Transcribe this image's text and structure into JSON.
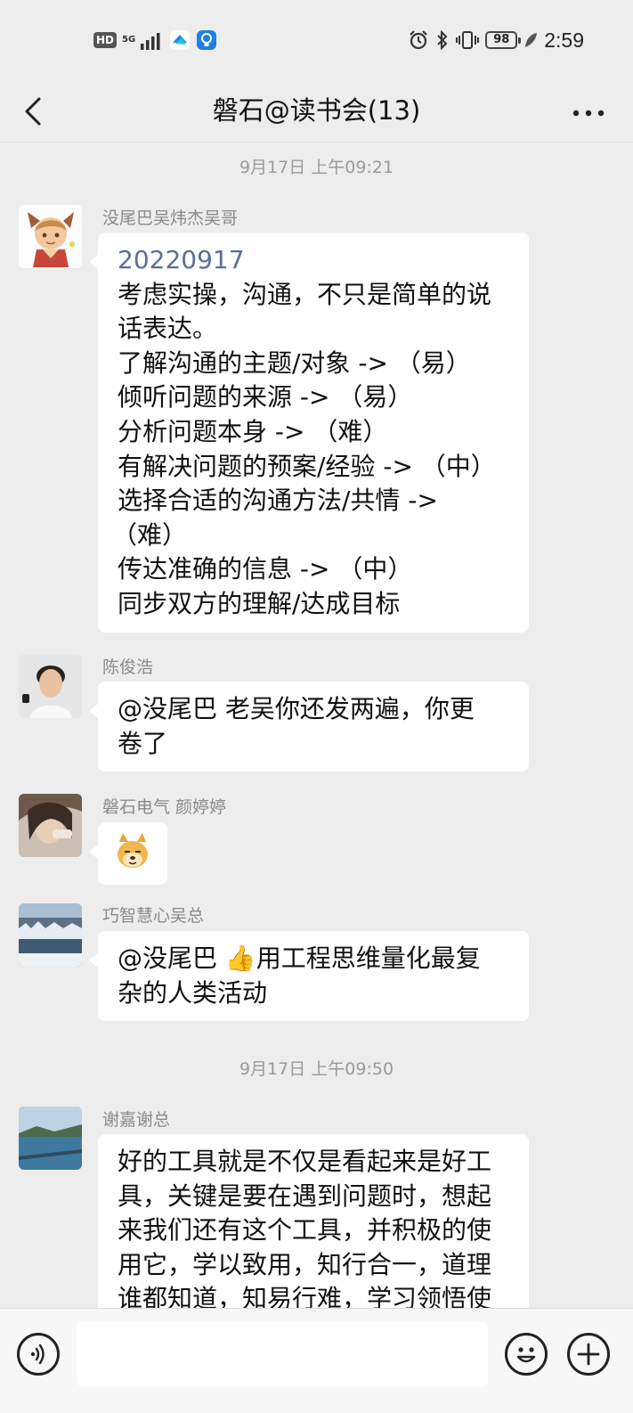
{
  "status_bar": {
    "network_badge": "HD",
    "network_gen": "5G",
    "battery": "98",
    "time": "2:59"
  },
  "nav": {
    "title": "磐石@读书会(13)"
  },
  "chat": {
    "timestamps": [
      "9月17日 上午09:21",
      "9月17日 上午09:50"
    ],
    "messages": [
      {
        "sender": "没尾巴吴炜杰吴哥",
        "lines": [
          "20220917",
          "考虑实操，沟通，不只是简单的说",
          "话表达。",
          "了解沟通的主题/对象 -> （易）",
          "倾听问题的来源 -> （易）",
          "分析问题本身 -> （难）",
          "有解决问题的预案/经验 -> （中）",
          "选择合适的沟通方法/共情 ->",
          "（难）",
          "传达准确的信息 -> （中）",
          "同步双方的理解/达成目标"
        ]
      },
      {
        "sender": "陈俊浩",
        "lines": [
          "@没尾巴  老吴你还发两遍，你更",
          "卷了"
        ]
      },
      {
        "sender": "磐石电气 颜婷婷",
        "sticker": "doge-sticker"
      },
      {
        "sender": "巧智慧心吴总",
        "lines": [
          "@没尾巴 👍用工程思维量化最复",
          "杂的人类活动"
        ]
      },
      {
        "sender": "谢嘉谢总",
        "lines": [
          "好的工具就是不仅是看起来是好工",
          "具，关键是要在遇到问题时，想起",
          "来我们还有这个工具，并积极的使",
          "用它，学以致用，知行合一，道理",
          "谁都知道，知易行难，学习领悟使"
        ]
      }
    ]
  },
  "input_bar": {
    "placeholder": "",
    "value": ""
  },
  "icons": {
    "back": "chevron-left-icon",
    "more": "more-dots-icon",
    "voice": "voice-icon",
    "emoji": "emoji-icon",
    "plus": "plus-icon"
  }
}
